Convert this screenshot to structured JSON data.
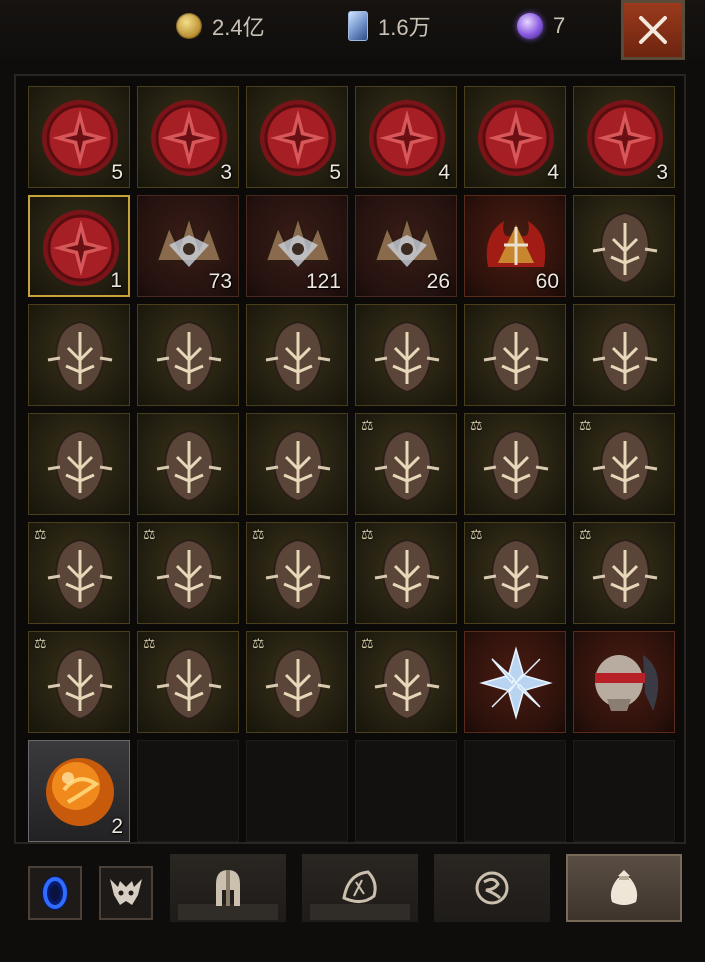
{
  "currencies": {
    "gold": {
      "icon": "gold-coin-icon",
      "value": "2.4亿"
    },
    "shard": {
      "icon": "blue-shard-icon",
      "value": "1.6万"
    },
    "orb": {
      "icon": "purple-orb-icon",
      "value": "7"
    }
  },
  "close_icon": "close-icon",
  "inventory": {
    "rows": [
      [
        {
          "item": "red-seal-icon",
          "count": "5"
        },
        {
          "item": "red-seal-icon",
          "count": "3"
        },
        {
          "item": "red-seal-icon",
          "count": "5"
        },
        {
          "item": "red-seal-icon",
          "count": "4"
        },
        {
          "item": "red-seal-icon",
          "count": "4"
        },
        {
          "item": "red-seal-icon",
          "count": "3"
        }
      ],
      [
        {
          "item": "red-seal-icon",
          "count": "1",
          "selected": true
        },
        {
          "item": "spiked-crown-icon",
          "count": "73"
        },
        {
          "item": "spiked-crown-icon",
          "count": "121"
        },
        {
          "item": "spiked-crown-icon",
          "count": "26"
        },
        {
          "item": "flaming-crest-icon",
          "count": "60"
        },
        {
          "item": "rune-stone-icon"
        }
      ],
      [
        {
          "item": "rune-stone-icon"
        },
        {
          "item": "rune-stone-icon"
        },
        {
          "item": "rune-stone-icon"
        },
        {
          "item": "rune-stone-icon"
        },
        {
          "item": "rune-stone-icon"
        },
        {
          "item": "rune-stone-icon"
        }
      ],
      [
        {
          "item": "rune-stone-icon"
        },
        {
          "item": "rune-stone-icon"
        },
        {
          "item": "rune-stone-icon"
        },
        {
          "item": "rune-stone-icon",
          "tradeable": true
        },
        {
          "item": "rune-stone-icon",
          "tradeable": true
        },
        {
          "item": "rune-stone-icon",
          "tradeable": true
        }
      ],
      [
        {
          "item": "rune-stone-icon",
          "tradeable": true
        },
        {
          "item": "rune-stone-icon",
          "tradeable": true
        },
        {
          "item": "rune-stone-icon",
          "tradeable": true
        },
        {
          "item": "rune-stone-icon",
          "tradeable": true
        },
        {
          "item": "rune-stone-icon",
          "tradeable": true
        },
        {
          "item": "rune-stone-icon",
          "tradeable": true
        }
      ],
      [
        {
          "item": "rune-stone-icon",
          "tradeable": true
        },
        {
          "item": "rune-stone-icon",
          "tradeable": true
        },
        {
          "item": "rune-stone-icon",
          "tradeable": true
        },
        {
          "item": "rune-stone-icon",
          "tradeable": true
        },
        {
          "item": "ice-crystal-icon"
        },
        {
          "item": "blindfolded-skull-icon"
        }
      ],
      [
        {
          "item": "fire-orb-icon",
          "count": "2"
        },
        {
          "item": ""
        },
        {
          "item": ""
        },
        {
          "item": ""
        },
        {
          "item": ""
        },
        {
          "item": ""
        }
      ]
    ],
    "tradeable_icon": "scales-icon"
  },
  "bottom_bar": {
    "buttons": [
      {
        "icon": "blue-portal-icon"
      },
      {
        "icon": "demon-head-icon"
      }
    ],
    "tabs": [
      {
        "icon": "helmet-icon"
      },
      {
        "icon": "rune-stone-icon"
      },
      {
        "icon": "gem-swirl-icon"
      },
      {
        "icon": "loot-bag-icon",
        "active": true
      }
    ]
  }
}
